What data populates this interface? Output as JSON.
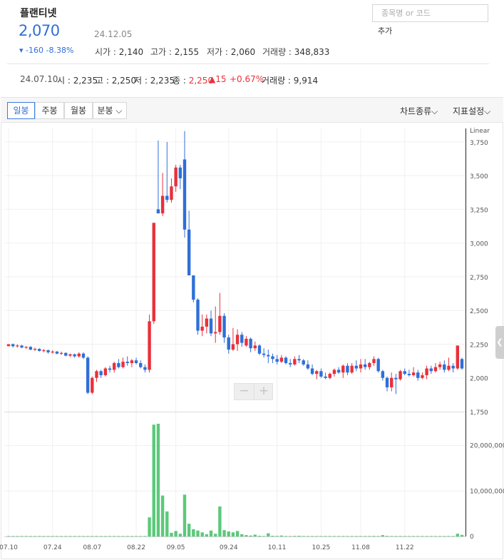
{
  "stock": {
    "name": "플랜티넷",
    "price": "2,070",
    "date": "24.12.05",
    "change": "▾ -160  -8.38%",
    "open_label": "시가 : ",
    "open": "2,140",
    "high_label": "고가 : ",
    "high": "2,155",
    "low_label": "저가 : ",
    "low": "2,060",
    "volume_label": "거래량 : ",
    "volume": "348,833"
  },
  "search": {
    "placeholder": "종목명 or 코드",
    "add_label": "추가"
  },
  "hover": {
    "date": "24.07.10",
    "open_label": "시 : ",
    "open": "2,235",
    "high_label": "고 : ",
    "high": "2,250",
    "low_label": "저 : ",
    "low": "2,235",
    "close_label": "종 : ",
    "close": "2,250",
    "change": "▲15",
    "change_pct": "+0.67%",
    "volume_label": "거래량 : ",
    "volume": "9,914"
  },
  "toolbar": {
    "tabs": [
      "일봉",
      "주봉",
      "월봉",
      "분봉 ⌵"
    ],
    "active_tab": 0,
    "chart_type_label": "차트종류⌵",
    "indicator_label": "지표설정⌵"
  },
  "zoom": {
    "minus": "−",
    "plus": "+"
  },
  "colors": {
    "up": "#e8313b",
    "down": "#2f6fd8",
    "volume": "#5cc97a",
    "price_text": "#2f6fd8"
  },
  "chart_data": {
    "type": "candlestick",
    "scale_label": "Linear",
    "price_axis": {
      "range": [
        1750,
        3850
      ],
      "ticks": [
        1750,
        2000,
        2250,
        2500,
        2750,
        3000,
        3250,
        3500,
        3750
      ],
      "tick_labels": [
        "1,750",
        "2,000",
        "2,250",
        "2,500",
        "2,750",
        "3,000",
        "3,250",
        "3,500",
        "3,750"
      ]
    },
    "volume_axis": {
      "range": [
        0,
        27000000
      ],
      "ticks": [
        0,
        10000000,
        20000000
      ],
      "tick_labels": [
        "0",
        "10,000,000",
        "20,000,000"
      ]
    },
    "x_labels": [
      "07.10",
      "07.24",
      "08.07",
      "08.22",
      "09.05",
      "09.24",
      "10.11",
      "10.25",
      "11.08",
      "11.22"
    ],
    "x_label_index": [
      0,
      10,
      19,
      29,
      38,
      50,
      61,
      71,
      80,
      90
    ],
    "candles": [
      [
        2235,
        2250,
        2235,
        2250
      ],
      [
        2250,
        2255,
        2225,
        2235
      ],
      [
        2235,
        2250,
        2225,
        2240
      ],
      [
        2240,
        2245,
        2220,
        2225
      ],
      [
        2225,
        2235,
        2215,
        2230
      ],
      [
        2230,
        2235,
        2205,
        2210
      ],
      [
        2210,
        2225,
        2200,
        2215
      ],
      [
        2215,
        2220,
        2195,
        2200
      ],
      [
        2200,
        2215,
        2190,
        2205
      ],
      [
        2205,
        2210,
        2180,
        2190
      ],
      [
        2190,
        2205,
        2180,
        2195
      ],
      [
        2195,
        2200,
        2175,
        2180
      ],
      [
        2180,
        2195,
        2170,
        2185
      ],
      [
        2185,
        2190,
        2160,
        2165
      ],
      [
        2165,
        2180,
        2155,
        2175
      ],
      [
        2175,
        2180,
        2150,
        2160
      ],
      [
        2160,
        2190,
        2150,
        2180
      ],
      [
        2180,
        2190,
        2140,
        2150
      ],
      [
        2150,
        2160,
        1880,
        1890
      ],
      [
        1890,
        2010,
        1880,
        2000
      ],
      [
        2000,
        2060,
        1970,
        2050
      ],
      [
        2050,
        2060,
        2000,
        2020
      ],
      [
        2020,
        2080,
        2010,
        2070
      ],
      [
        2070,
        2090,
        2040,
        2060
      ],
      [
        2060,
        2120,
        2040,
        2110
      ],
      [
        2110,
        2140,
        2070,
        2080
      ],
      [
        2080,
        2150,
        2070,
        2120
      ],
      [
        2120,
        2160,
        2090,
        2110
      ],
      [
        2110,
        2140,
        2080,
        2130
      ],
      [
        2130,
        2150,
        2100,
        2110
      ],
      [
        2110,
        2130,
        2070,
        2080
      ],
      [
        2080,
        2100,
        2040,
        2060
      ],
      [
        2060,
        2470,
        2040,
        2420
      ],
      [
        2420,
        3150,
        2400,
        3150
      ],
      [
        3250,
        3760,
        3220,
        3220
      ],
      [
        3220,
        3520,
        3200,
        3350
      ],
      [
        3350,
        3750,
        3300,
        3320
      ],
      [
        3320,
        3480,
        3300,
        3420
      ],
      [
        3420,
        3580,
        3380,
        3560
      ],
      [
        3560,
        3580,
        3400,
        3480
      ],
      [
        3620,
        3830,
        3040,
        3100
      ],
      [
        3100,
        3240,
        2950,
        2760
      ],
      [
        2760,
        2760,
        2560,
        2580
      ],
      [
        2580,
        2590,
        2320,
        2350
      ],
      [
        2350,
        2470,
        2310,
        2380
      ],
      [
        2380,
        2470,
        2330,
        2440
      ],
      [
        2440,
        2500,
        2310,
        2330
      ],
      [
        2330,
        2530,
        2260,
        2340
      ],
      [
        2340,
        2630,
        2320,
        2460
      ],
      [
        2460,
        2480,
        2260,
        2300
      ],
      [
        2300,
        2320,
        2180,
        2210
      ],
      [
        2210,
        2370,
        2200,
        2250
      ],
      [
        2250,
        2360,
        2200,
        2320
      ],
      [
        2320,
        2340,
        2230,
        2260
      ],
      [
        2240,
        2310,
        2230,
        2290
      ],
      [
        2290,
        2300,
        2190,
        2220
      ],
      [
        2220,
        2270,
        2200,
        2240
      ],
      [
        2240,
        2250,
        2170,
        2180
      ],
      [
        2180,
        2220,
        2150,
        2170
      ],
      [
        2170,
        2210,
        2110,
        2160
      ],
      [
        2160,
        2180,
        2110,
        2140
      ],
      [
        2140,
        2170,
        2100,
        2120
      ],
      [
        2120,
        2170,
        2110,
        2150
      ],
      [
        2150,
        2160,
        2100,
        2110
      ],
      [
        2110,
        2140,
        2080,
        2100
      ],
      [
        2100,
        2160,
        2090,
        2140
      ],
      [
        2140,
        2170,
        2110,
        2130
      ],
      [
        2130,
        2140,
        2090,
        2100
      ],
      [
        2100,
        2130,
        2060,
        2070
      ],
      [
        2070,
        2100,
        2020,
        2030
      ],
      [
        2030,
        2060,
        1990,
        2050
      ],
      [
        2050,
        2070,
        2000,
        2010
      ],
      [
        2010,
        2040,
        1990,
        2000
      ],
      [
        2000,
        2040,
        1990,
        2030
      ],
      [
        2030,
        2070,
        2010,
        2060
      ],
      [
        2060,
        2080,
        2030,
        2040
      ],
      [
        2040,
        2100,
        2000,
        2090
      ],
      [
        2090,
        2110,
        2020,
        2040
      ],
      [
        2040,
        2110,
        2030,
        2090
      ],
      [
        2090,
        2130,
        2050,
        2070
      ],
      [
        2070,
        2140,
        2040,
        2100
      ],
      [
        2100,
        2140,
        2060,
        2080
      ],
      [
        2080,
        2120,
        2060,
        2110
      ],
      [
        2110,
        2160,
        2090,
        2140
      ],
      [
        2140,
        2150,
        2040,
        2050
      ],
      [
        2050,
        2060,
        1980,
        2000
      ],
      [
        2000,
        2010,
        1900,
        1930
      ],
      [
        1930,
        2040,
        1900,
        2000
      ],
      [
        2000,
        2030,
        1880,
        1990
      ],
      [
        1990,
        2060,
        1980,
        2050
      ],
      [
        2050,
        2070,
        2020,
        2030
      ],
      [
        2030,
        2060,
        2010,
        2020
      ],
      [
        2020,
        2080,
        2010,
        2040
      ],
      [
        2040,
        2060,
        1980,
        2000
      ],
      [
        2000,
        2040,
        1990,
        2020
      ],
      [
        2020,
        2090,
        1990,
        2070
      ],
      [
        2070,
        2090,
        2030,
        2050
      ],
      [
        2050,
        2110,
        2040,
        2080
      ],
      [
        2080,
        2120,
        2060,
        2100
      ],
      [
        2100,
        2130,
        2040,
        2060
      ],
      [
        2060,
        2150,
        2050,
        2090
      ],
      [
        2090,
        2110,
        2040,
        2070
      ],
      [
        2070,
        2240,
        2060,
        2240
      ],
      [
        2140,
        2150,
        2060,
        2070
      ]
    ],
    "volumes": [
      9914,
      20000,
      15000,
      12000,
      10000,
      18000,
      14000,
      16000,
      11000,
      13000,
      15000,
      12000,
      17000,
      19000,
      14000,
      12000,
      21000,
      15000,
      80000,
      60000,
      40000,
      30000,
      35000,
      25000,
      40000,
      30000,
      50000,
      25000,
      20000,
      30000,
      40000,
      35000,
      4200000,
      24600000,
      24800000,
      9000000,
      5500000,
      800000,
      1200000,
      600000,
      9200000,
      2800000,
      1600000,
      1300000,
      900000,
      500000,
      1300000,
      600000,
      6600000,
      1400000,
      1100000,
      900000,
      1200000,
      500000,
      300000,
      200000,
      400000,
      150000,
      100000,
      700000,
      150000,
      120000,
      200000,
      100000,
      80000,
      120000,
      150000,
      90000,
      80000,
      70000,
      80000,
      60000,
      50000,
      70000,
      60000,
      50000,
      90000,
      80000,
      70000,
      60000,
      90000,
      70000,
      80000,
      120000,
      100000,
      300000,
      120000,
      80000,
      70000,
      90000,
      50000,
      60000,
      40000,
      50000,
      40000,
      60000,
      50000,
      40000,
      80000,
      50000,
      70000,
      60000,
      600000,
      348833
    ]
  }
}
